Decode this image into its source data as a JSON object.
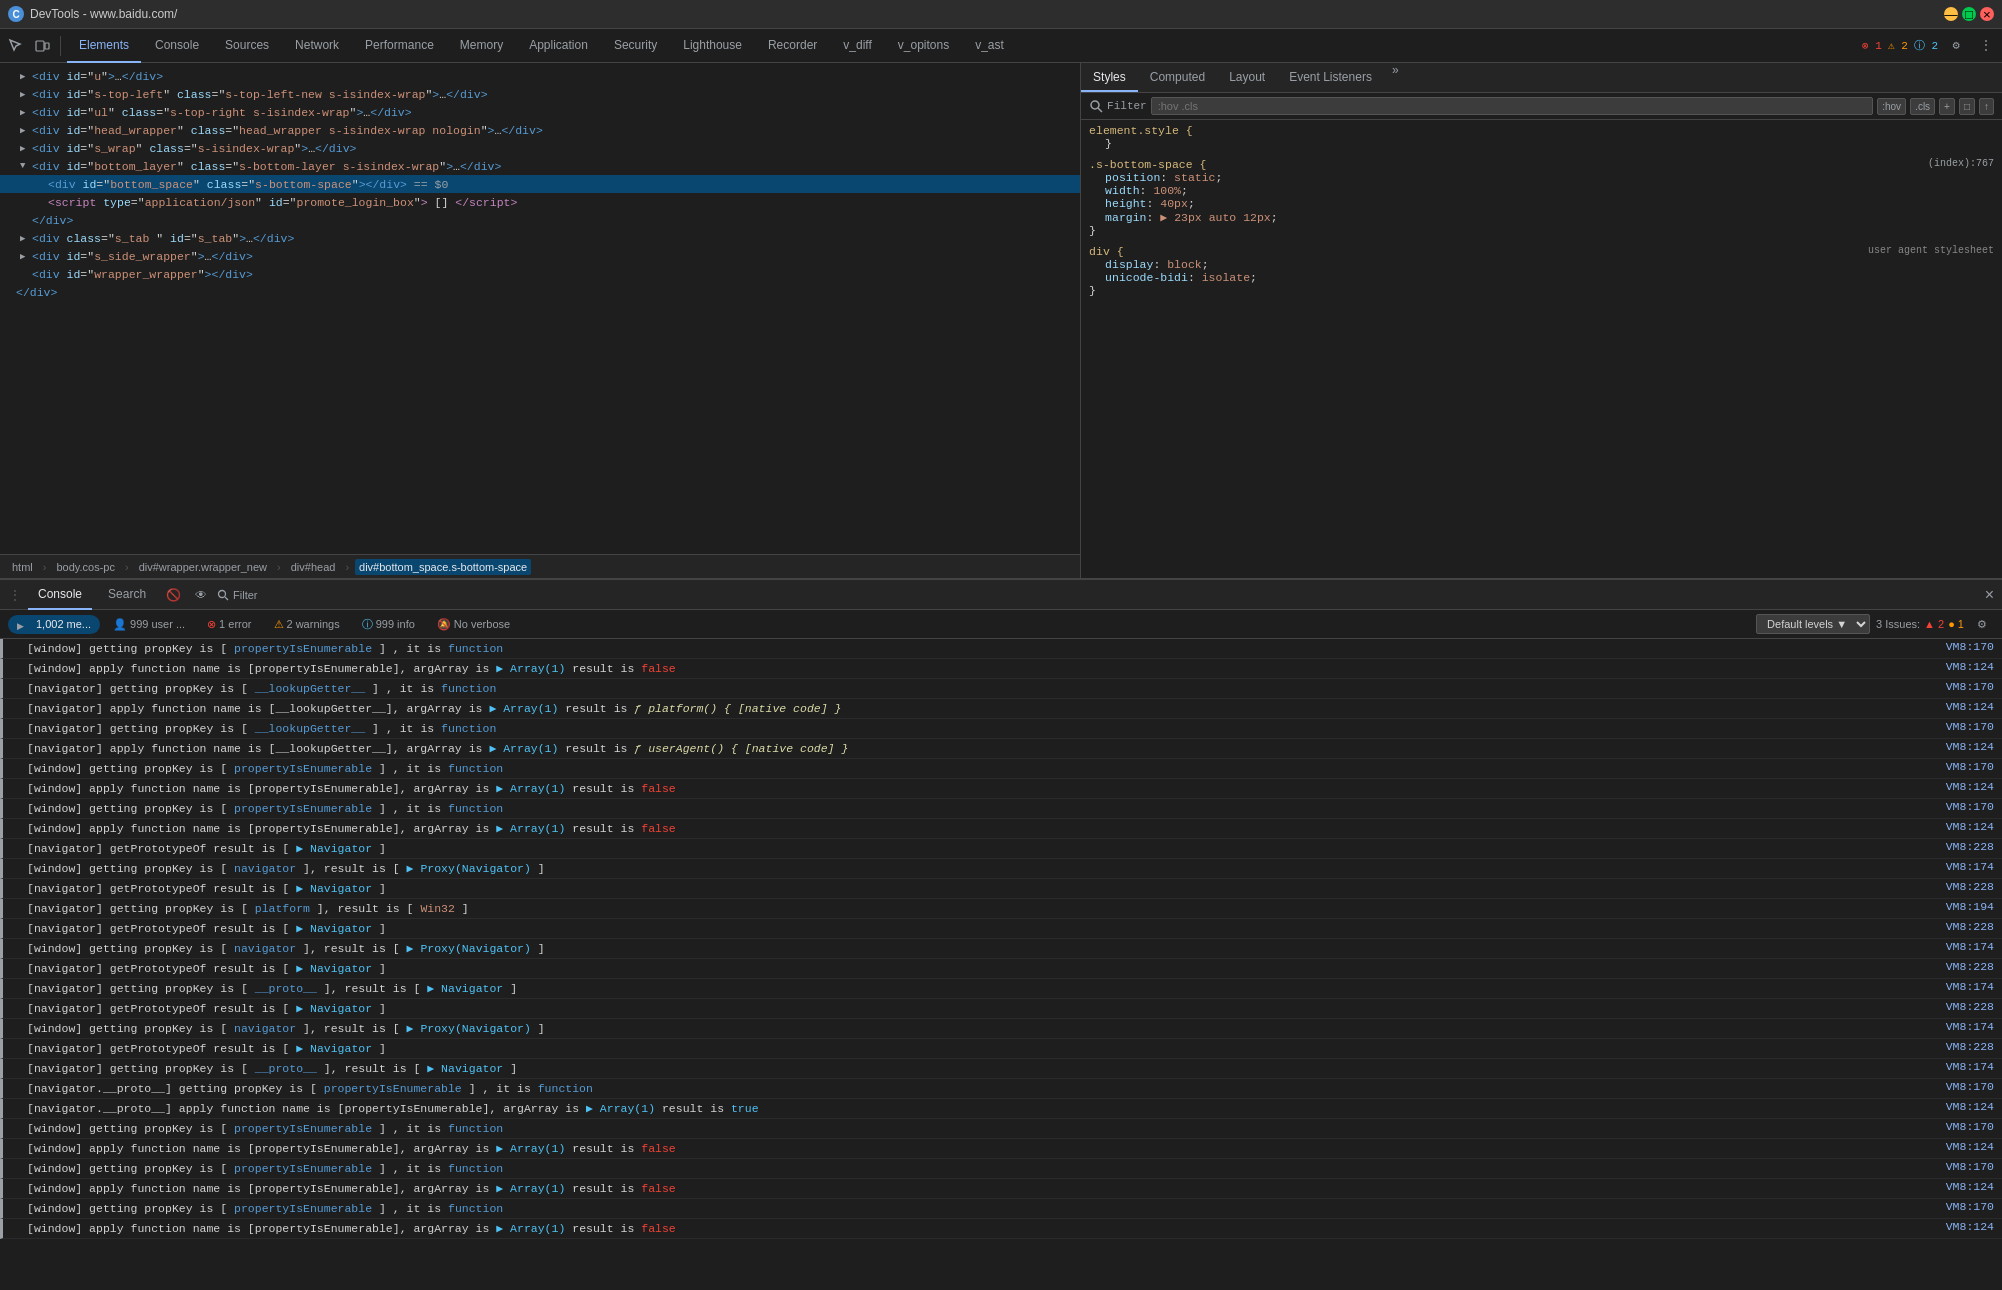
{
  "titlebar": {
    "favicon_label": "C",
    "title": "DevTools - www.baidu.com/"
  },
  "top_toolbar": {
    "icons": [
      "cursor-pointer-icon",
      "device-toggle-icon"
    ],
    "tabs": [
      {
        "label": "Elements",
        "active": true
      },
      {
        "label": "Console",
        "active": false
      },
      {
        "label": "Sources",
        "active": false
      },
      {
        "label": "Network",
        "active": false
      },
      {
        "label": "Performance",
        "active": false
      },
      {
        "label": "Memory",
        "active": false
      },
      {
        "label": "Application",
        "active": false
      },
      {
        "label": "Security",
        "active": false
      },
      {
        "label": "Lighthouse",
        "active": false
      },
      {
        "label": "Recorder",
        "active": false
      },
      {
        "label": "v_diff",
        "active": false
      },
      {
        "label": "v_opitons",
        "active": false
      },
      {
        "label": "v_ast",
        "active": false
      }
    ],
    "badges": {
      "errors": "1",
      "warnings": "2",
      "info": "2"
    }
  },
  "elements_tree": [
    {
      "indent": 2,
      "collapsed": false,
      "html": "&lt;div id=\"u\"&gt;…&lt;/div&gt;",
      "type": "tag"
    },
    {
      "indent": 2,
      "collapsed": true,
      "html": "&lt;div id=\"s-top-left\" class=\"s-top-left-new s-isindex-wrap\"&gt;…&lt;/div&gt;",
      "type": "tag"
    },
    {
      "indent": 2,
      "collapsed": true,
      "html": "&lt;div id=\"ul\" class=\"s-top-right s-isindex-wrap\"&gt;…&lt;/div&gt;",
      "type": "tag"
    },
    {
      "indent": 2,
      "collapsed": true,
      "html": "&lt;div id=\"head_wrapper\" class=\"head_wrapper s-isindex-wrap nologin\"&gt;…&lt;/div&gt;",
      "type": "tag"
    },
    {
      "indent": 2,
      "collapsed": true,
      "html": "&lt;div id=\"s_wrap\" class=\"s-isindex-wrap\"&gt;…&lt;/div&gt;",
      "type": "tag"
    },
    {
      "indent": 2,
      "collapsed": false,
      "html": "&lt;div id=\"bottom_layer\" class=\"s-bottom-layer s-isindex-wrap\"&gt;…&lt;/div&gt;",
      "type": "tag"
    },
    {
      "indent": 4,
      "collapsed": false,
      "html": "&lt;div id=\"bottom_space\" class=\"s-bottom-space\"&gt;&lt;/div&gt; == $0",
      "type": "tag",
      "selected": true
    },
    {
      "indent": 4,
      "collapsed": false,
      "html": "&lt;script type=\"application/json\" id=\"promote_login_box\"&gt; [] &lt;/script&gt;",
      "type": "script"
    },
    {
      "indent": 2,
      "collapsed": false,
      "html": "&lt;/div&gt;",
      "type": "close"
    },
    {
      "indent": 2,
      "collapsed": true,
      "html": "&lt;div class=\"s_tab \" id=\"s_tab\"&gt;…&lt;/div&gt;",
      "type": "tag"
    },
    {
      "indent": 2,
      "collapsed": true,
      "html": "&lt;div id=\"s_side_wrapper\"&gt;…&lt;/div&gt;",
      "type": "tag"
    },
    {
      "indent": 2,
      "collapsed": false,
      "html": "&lt;div id=\"wrapper_wrapper\"&gt;&lt;/div&gt;",
      "type": "tag"
    },
    {
      "indent": 0,
      "collapsed": false,
      "html": "&lt;/div&gt;",
      "type": "close"
    }
  ],
  "breadcrumb": {
    "items": [
      {
        "label": "html",
        "active": false
      },
      {
        "label": "body.cos-pc",
        "active": false
      },
      {
        "label": "div#wrapper.wrapper_new",
        "active": false
      },
      {
        "label": "div#head",
        "active": false
      },
      {
        "label": "div#bottom_space.s-bottom-space",
        "active": true
      }
    ]
  },
  "styles_panel": {
    "tabs": [
      "Styles",
      "Computed",
      "Layout",
      "Event Listeners"
    ],
    "filter_placeholder": ":hov .cls",
    "filter_buttons": [
      "+",
      "□",
      "↑"
    ],
    "rules": [
      {
        "selector": "element.style {",
        "origin": "",
        "properties": [
          {
            "prop": "}",
            "val": ""
          }
        ]
      },
      {
        "selector": ".s-bottom-space {",
        "origin": "(index):767",
        "properties": [
          {
            "prop": "position",
            "val": "static;"
          },
          {
            "prop": "width",
            "val": "100%;"
          },
          {
            "prop": "height",
            "val": "40px;"
          },
          {
            "prop": "margin",
            "val": "▶ 23px auto 12px;"
          }
        ]
      },
      {
        "selector": "div {",
        "origin": "user agent stylesheet",
        "properties": [
          {
            "prop": "display",
            "val": "block;"
          },
          {
            "prop": "unicode-bidi",
            "val": "isolate;"
          }
        ]
      }
    ]
  },
  "console_panel": {
    "tabs": [
      "Console",
      "Search"
    ],
    "filter_placeholder": "Filter",
    "filter_counts": {
      "messages": "1,002 me...",
      "user": "999 user ...",
      "errors": "1 error",
      "warnings": "2 warnings",
      "info": "999 info",
      "verbose": "No verbose"
    },
    "default_levels": "Default levels ▼",
    "issues": "3 Issues: ▲ 2 ● 1",
    "log_entries": [
      {
        "type": "log",
        "text": "[window] getting propKey is [ propertyIsEnumerable ] , it is function",
        "link": "VM8:170"
      },
      {
        "type": "log",
        "text": "[window] apply function name is [propertyIsEnumerable], argArray is  ▶ Array(1) result is false",
        "link": "VM8:124",
        "has_false": true
      },
      {
        "type": "log",
        "text": "[navigator] getting propKey is [ __lookupGetter__ ] , it is function",
        "link": "VM8:170"
      },
      {
        "type": "log",
        "text": "[navigator] apply function name is [__lookupGetter__], argArray is  ▶ Array(1) result is  / platform() { [native code] }",
        "link": "VM8:124"
      },
      {
        "type": "log",
        "text": "[navigator] getting propKey is [ __lookupGetter__ ] , it is function",
        "link": "VM8:170"
      },
      {
        "type": "log",
        "text": "[navigator] apply function name is [__lookupGetter__], argArray is  ▶ Array(1) result is  / userAgent() { [native code] }",
        "link": "VM8:124"
      },
      {
        "type": "log",
        "text": "[window] getting propKey is [ propertyIsEnumerable ] , it is function",
        "link": "VM8:170"
      },
      {
        "type": "log",
        "text": "[window] apply function name is [propertyIsEnumerable], argArray is  ▶ Array(1) result is false",
        "link": "VM8:124",
        "has_false": true
      },
      {
        "type": "log",
        "text": "[window] getting propKey is [ propertyIsEnumerable ] , it is function",
        "link": "VM8:170"
      },
      {
        "type": "log",
        "text": "[window] apply function name is [propertyIsEnumerable], argArray is  ▶ Array(1) result is false",
        "link": "VM8:124",
        "has_false": true
      },
      {
        "type": "log",
        "text": "[navigator] getPrototypeOf result is [  ▶ Navigator ]",
        "link": "VM8:228"
      },
      {
        "type": "log",
        "text": "[window] getting propKey is [ navigator ], result is [  ▶ Proxy(Navigator) ]",
        "link": "VM8:174"
      },
      {
        "type": "log",
        "text": "[navigator] getPrototypeOf result is [  ▶ Navigator ]",
        "link": "VM8:228"
      },
      {
        "type": "log",
        "text": "[navigator] getting propKey is [ platform ], result is [ Win32 ]",
        "link": "VM8:194"
      },
      {
        "type": "log",
        "text": "[navigator] getPrototypeOf result is [  ▶ Navigator ]",
        "link": "VM8:228"
      },
      {
        "type": "log",
        "text": "[window] getting propKey is [ navigator ], result is [  ▶ Proxy(Navigator) ]",
        "link": "VM8:174"
      },
      {
        "type": "log",
        "text": "[navigator] getPrototypeOf result is [  ▶ Navigator ]",
        "link": "VM8:228"
      },
      {
        "type": "log",
        "text": "[navigator] getting propKey is [ __proto__ ], result is [  ▶ Navigator ]",
        "link": "VM8:174"
      },
      {
        "type": "log",
        "text": "[navigator] getPrototypeOf result is [  ▶ Navigator ]",
        "link": "VM8:228"
      },
      {
        "type": "log",
        "text": "[window] getting propKey is [ navigator ], result is [  ▶ Proxy(Navigator) ]",
        "link": "VM8:174"
      },
      {
        "type": "log",
        "text": "[navigator] getPrototypeOf result is [  ▶ Navigator ]",
        "link": "VM8:228"
      },
      {
        "type": "log",
        "text": "[navigator] getting propKey is [ __proto__ ], result is [  ▶ Navigator ]",
        "link": "VM8:174"
      },
      {
        "type": "log",
        "text": "[navigator.__proto__] getting propKey is [ propertyIsEnumerable ] , it is function",
        "link": "VM8:170"
      },
      {
        "type": "log",
        "text": "[navigator.__proto__] apply function name is [propertyIsEnumerable], argArray is  ▶ Array(1) result is true",
        "link": "VM8:124",
        "has_true": true
      },
      {
        "type": "log",
        "text": "[window] getting propKey is [ propertyIsEnumerable ] , it is function",
        "link": "VM8:170"
      },
      {
        "type": "log",
        "text": "[window] apply function name is [propertyIsEnumerable], argArray is  ▶ Array(1) result is false",
        "link": "VM8:124",
        "has_false": true
      },
      {
        "type": "log",
        "text": "[window] getting propKey is [ propertyIsEnumerable ] , it is function",
        "link": "VM8:170"
      },
      {
        "type": "log",
        "text": "[window] apply function name is [propertyIsEnumerable], argArray is  ▶ Array(1) result is false",
        "link": "VM8:124",
        "has_false": true
      },
      {
        "type": "log",
        "text": "[window] getting propKey is [ propertyIsEnumerable ] , it is function",
        "link": "VM8:170"
      },
      {
        "type": "log",
        "text": "[window] apply function name is [propertyIsEnumerable], argArray is  ▶ Array(1) result is false",
        "link": "VM8:124",
        "has_false": true
      }
    ]
  }
}
